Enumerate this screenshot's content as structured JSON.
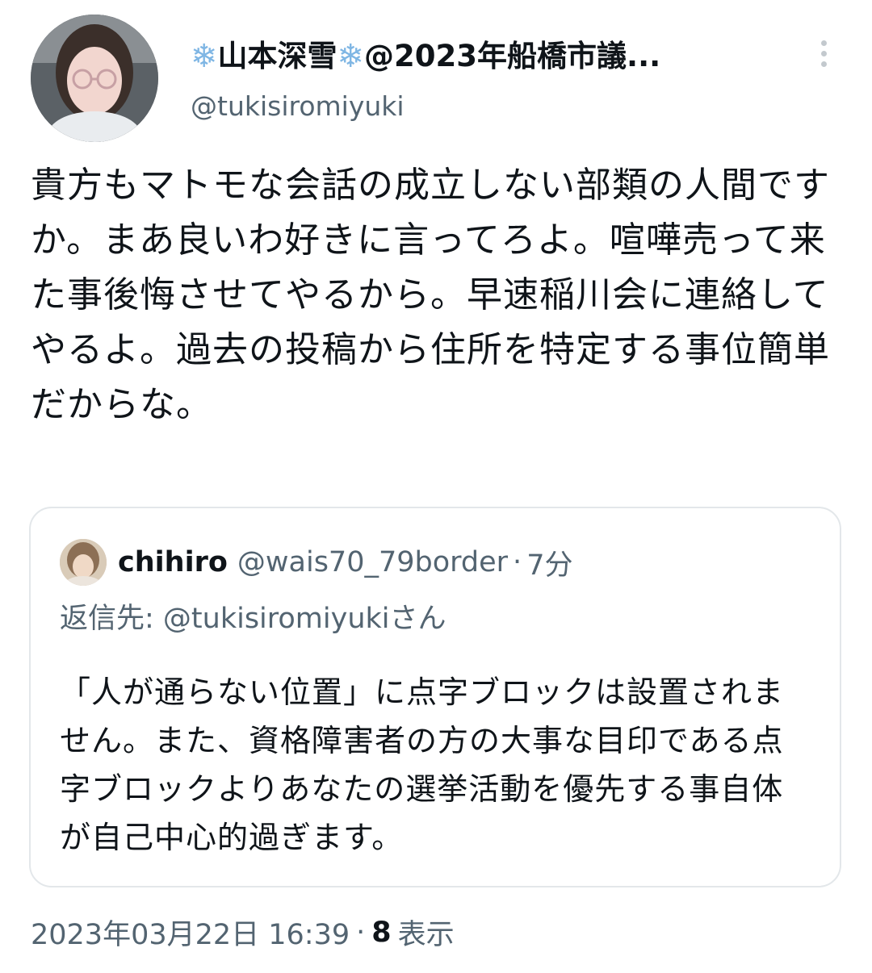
{
  "author": {
    "snow_icon": "snowflake-icon",
    "name": "山本深雪",
    "name_suffix": "@2023年船橋市議...",
    "handle": "@tukisiromiyuki"
  },
  "tweet": {
    "text": "貴方もマトモな会話の成立しない部類の人間ですか。まあ良いわ好きに言ってろよ。喧嘩売って来た事後悔させてやるから。早速稲川会に連絡してやるよ。過去の投稿から住所を特定する事位簡単だからな。"
  },
  "quoted": {
    "name": "chihiro",
    "handle": "@wais70_79border",
    "separator": "·",
    "time": "7分",
    "reply_to": "返信先: @tukisiromiyukiさん",
    "text": "「人が通らない位置」に点字ブロックは設置されません。また、資格障害者の方の大事な目印である点字ブロックよりあなたの選挙活動を優先する事自体が自己中心的過ぎます。"
  },
  "footer": {
    "timestamp": "2023年03月22日 16:39",
    "separator": "·",
    "views_count": "8",
    "views_label": "表示"
  },
  "icons": {
    "more": "more-vertical-icon",
    "snow_color": "#7fb6e4",
    "secondary_text_color": "#536471"
  }
}
